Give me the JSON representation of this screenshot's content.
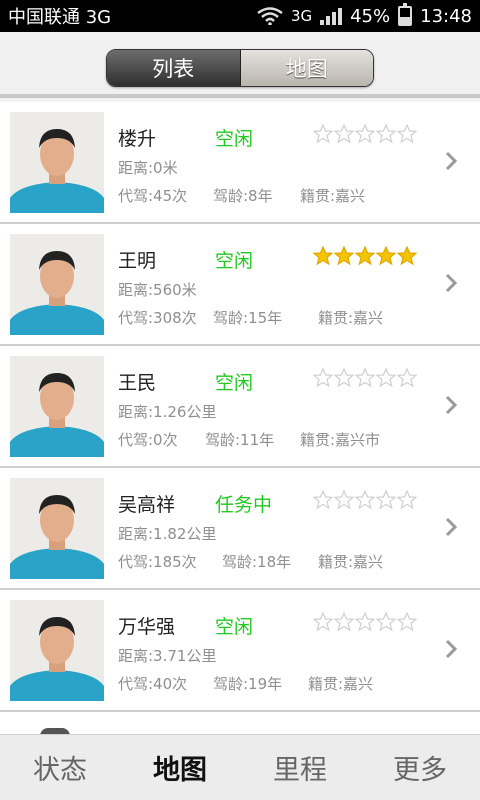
{
  "statusbar": {
    "carrier": "中国联通 3G",
    "network": "3G",
    "battery": "45%",
    "battery_level": 0.45,
    "time": "13:48"
  },
  "segment": {
    "tabs": [
      {
        "label": "列表",
        "active": true
      },
      {
        "label": "地图",
        "active": false
      }
    ]
  },
  "drivers": [
    {
      "name": "楼升",
      "status": "空闲",
      "rating": 0,
      "distance": "距离:0米",
      "trips": "代驾:45次",
      "years": "驾龄:8年",
      "origin": "籍贯:嘉兴"
    },
    {
      "name": "王明",
      "status": "空闲",
      "rating": 5,
      "distance": "距离:560米",
      "trips": "代驾:308次",
      "years": "驾龄:15年",
      "origin": "籍贯:嘉兴"
    },
    {
      "name": "王民",
      "status": "空闲",
      "rating": 0,
      "distance": "距离:1.26公里",
      "trips": "代驾:0次",
      "years": "驾龄:11年",
      "origin": "籍贯:嘉兴市"
    },
    {
      "name": "吴高祥",
      "status": "任务中",
      "rating": 0,
      "distance": "距离:1.82公里",
      "trips": "代驾:185次",
      "years": "驾龄:18年",
      "origin": "籍贯:嘉兴"
    },
    {
      "name": "万华强",
      "status": "空闲",
      "rating": 0,
      "distance": "距离:3.71公里",
      "trips": "代驾:40次",
      "years": "驾龄:19年",
      "origin": "籍贯:嘉兴"
    }
  ],
  "colors": {
    "status_text": "#22c922",
    "star_filled": "#f5c400",
    "star_empty": "#cfcfcf",
    "shirt": "#2aa3c8"
  },
  "bottomnav": {
    "items": [
      {
        "label": "状态",
        "active": false
      },
      {
        "label": "地图",
        "active": true
      },
      {
        "label": "里程",
        "active": false
      },
      {
        "label": "更多",
        "active": false
      }
    ]
  }
}
